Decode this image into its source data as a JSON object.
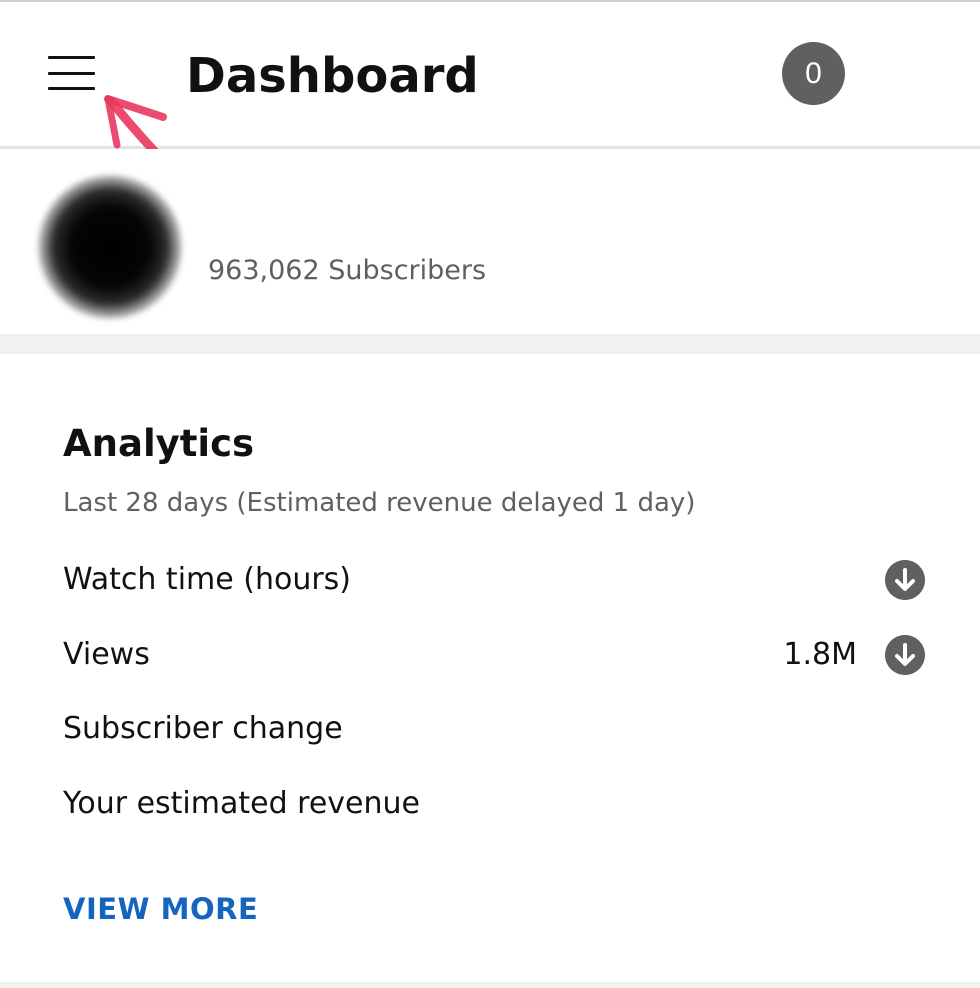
{
  "header": {
    "title": "Dashboard",
    "notification_count": "0"
  },
  "channel": {
    "subscribers": "963,062 Subscribers"
  },
  "analytics": {
    "title": "Analytics",
    "subtitle": "Last 28 days (Estimated revenue delayed 1 day)",
    "metrics": [
      {
        "label": "Watch time (hours)",
        "value": "",
        "trend": "down"
      },
      {
        "label": "Views",
        "value": "1.8M",
        "trend": "down"
      },
      {
        "label": "Subscriber change",
        "value": ""
      },
      {
        "label": "Your estimated revenue",
        "value": ""
      }
    ],
    "view_more_label": "VIEW MORE"
  },
  "colors": {
    "link": "#1565c0",
    "icon_gray": "#606060",
    "annotation": "#e8375e"
  },
  "icons": {
    "menu": "hamburger-menu-icon",
    "trend_down": "arrow-down-circle-icon",
    "annotation": "arrow-annotation"
  }
}
